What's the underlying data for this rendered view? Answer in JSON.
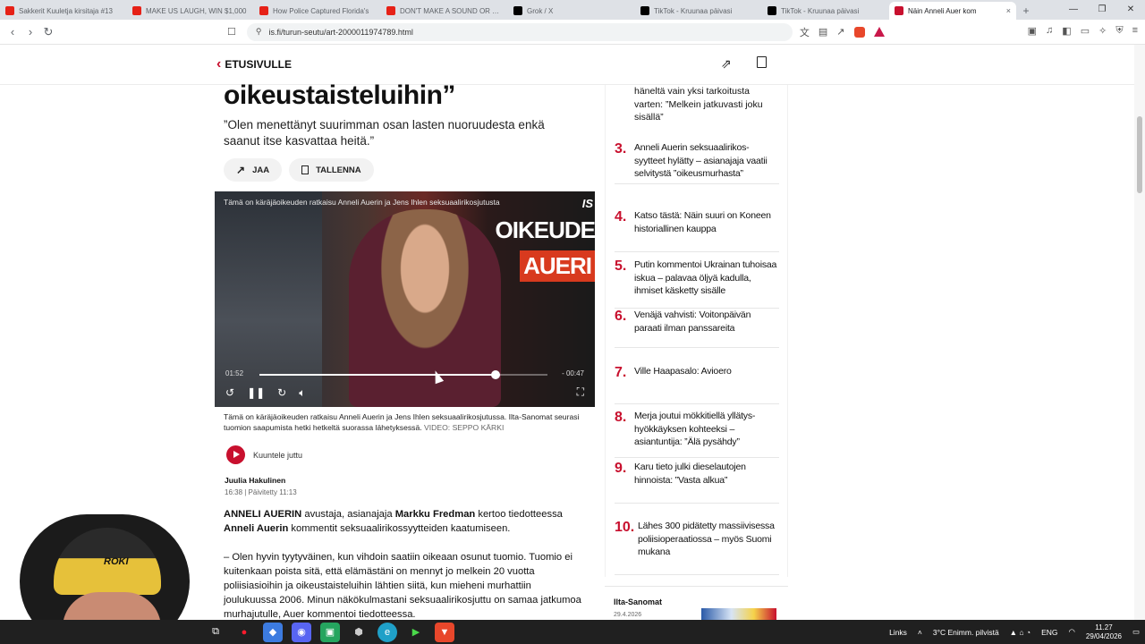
{
  "browser": {
    "tabs": [
      {
        "title": "Sakkerit Kuuletja kirsitaja #13",
        "color": "#e62117"
      },
      {
        "title": "MAKE US LAUGH, WIN $1,000",
        "color": "#e62117"
      },
      {
        "title": "How Police Captured Florida's",
        "color": "#e62117"
      },
      {
        "title": "DON'T MAKE A SOUND OR YOU",
        "color": "#e62117"
      },
      {
        "title": "Grok / X",
        "color": "#000000"
      },
      {
        "title": "TikTok - Kruunaa päivasi",
        "color": "#000000"
      },
      {
        "title": "TikTok - Kruunaa päivasi",
        "color": "#000000"
      },
      {
        "title": "Näin Anneli Auer kom",
        "color": "#c8102e",
        "active": true
      }
    ],
    "url": "is.fi/turun-seutu/art-2000011974789.html"
  },
  "site": {
    "back_label": "ETUSIVULLE",
    "share_icon": "share-icon",
    "save_icon": "bookmark-icon"
  },
  "article": {
    "headline": "oikeustaisteluihin”",
    "ingress": "”Olen menettänyt suurimman osan lasten nuoruudesta enkä saanut itse kasvattaa heitä.”",
    "share_label": "JAA",
    "save_label": "TALLENNA",
    "video": {
      "caption_top": "Tämä on käräjäoikeuden ratkaisu Anneli Auerin ja Jens Ihlen seksuaalirikosjutusta",
      "logo": "IS",
      "overlay_line1": "OIKEUDE",
      "overlay_line2": "AUERI",
      "time_elapsed": "01:52",
      "time_remaining": "- 00:47",
      "progress": 0.82
    },
    "video_caption": "Tämä on käräjäoikeuden ratkaisu Anneli Auerin ja Jens Ihlen seksuaalirikosjutussa. Ilta-Sanomat seurasi tuomion saapumista hetki hetkeltä suorassa lähetyksessä.",
    "video_credit": "VIDEO: SEPPO KÄRKI",
    "listen_label": "Kuuntele juttu",
    "author": "Juulia Hakulinen",
    "dates": "16:38 | Päivitetty 11:13",
    "body1": {
      "p1": "ANNELI AUERIN",
      "p2": " avustaja, asianajaja ",
      "p3": "Markku Fredman",
      "p4": " kertoo tiedotteessa ",
      "p5": "Anneli Auerin",
      "p6": " kommentit seksuaalirikossyytteiden kaatumiseen."
    },
    "body2": "– Olen hyvin tyytyväinen, kun vihdoin saatiin oikeaan osunut tuomio. Tuomio ei kuitenkaan poista sitä, että elämästäni on mennyt jo melkein 20 vuotta poliisiasioihin ja oikeustaisteluihin lähtien siitä, kun mieheni murhattiin joulukuussa 2006. Minun näkökulmastani seksuaalirikosjuttu on samaa jatkumoa murhajutulle, Auer kommentoi tiedotteessa."
  },
  "most_read": {
    "top_partial": "häneltä vain yksi tarkoitusta varten: ”Melkein jatkuvasti joku sisällä”",
    "items": [
      {
        "num": "3.",
        "text": "Anneli Auerin seksuaalirikos-syytteet hylätty – asianajaja vaatii selvitystä ”oikeusmurhasta”"
      },
      {
        "num": "4.",
        "text": "Katso tästä: Näin suuri on Koneen historiallinen kauppa"
      },
      {
        "num": "5.",
        "text": "Putin kommentoi Ukrainan tuhoisaa iskua – palavaa öljyä kadulla, ihmiset käsketty sisälle"
      },
      {
        "num": "6.",
        "text": "Venäjä vahvisti: Voitonpäivän paraati ilman panssareita"
      },
      {
        "num": "7.",
        "text": "Ville Haapasalo: Avioero"
      },
      {
        "num": "8.",
        "text": "Merja joutui mökkitiellä yllätys-hyökkäyksen kohteeksi – asiantuntija: ”Älä pysähdy”"
      },
      {
        "num": "9.",
        "text": "Karu tieto julki dieselautojen hinnoista: ”Vasta alkua”"
      },
      {
        "num": "10.",
        "text": "Lähes 300 pidätetty massiivisessa poliisioperaatiossa – myös Suomi mukana"
      }
    ]
  },
  "paper": {
    "name": "Ilta-Sanomat",
    "date": "29.4.2026"
  },
  "webcam": {
    "cap_text": "ROKI"
  },
  "taskbar": {
    "links_label": "Links",
    "weather": "3°C  Enimm. pilvistä",
    "lang": "ENG",
    "time": "11.27",
    "date": "29/04/2026"
  },
  "colors": {
    "accent": "#c8102e",
    "brand_red": "#c8102e"
  }
}
